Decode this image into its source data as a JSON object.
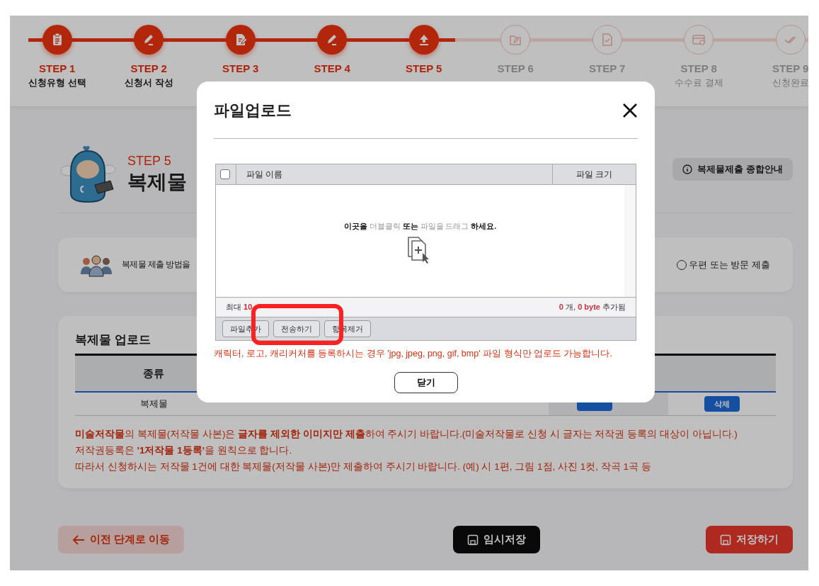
{
  "steps": [
    {
      "label": "STEP 1",
      "sublabel": "신청유형 선택",
      "done": true
    },
    {
      "label": "STEP 2",
      "sublabel": "신청서 작성",
      "done": true
    },
    {
      "label": "STEP 3",
      "done": true
    },
    {
      "label": "STEP 4",
      "done": true
    },
    {
      "label": "STEP 5",
      "done": true
    },
    {
      "label": "STEP 6",
      "done": false
    },
    {
      "label": "STEP 7",
      "done": false
    },
    {
      "label": "STEP 8",
      "sublabel": "수수료 결제",
      "done": false
    },
    {
      "label": "STEP 9",
      "sublabel": "신청완료",
      "done": false
    }
  ],
  "page_title": {
    "step": "STEP 5",
    "title": "복제물"
  },
  "guide_button": "복제물제출 종합안내",
  "method": {
    "label": "복제물 제출 방법을",
    "options": [
      {
        "label": "우편 또는 방문 제출",
        "selected": false
      }
    ]
  },
  "upload_section": {
    "title": "복제물 업로드",
    "columns": [
      "종류"
    ],
    "rows": [
      {
        "cells": [
          "복제물"
        ],
        "delete_button": "삭제"
      }
    ]
  },
  "notes": [
    "**미술저작물**의 복제물(저작물 사본)은 **글자를 제외한 이미지만 제출**하여 주시기 바랍니다.(미술저작물로 신청 시 글자는 저작권 등록의 대상이 아닙니다.)",
    "저작권등록은 **'1저작물 1등록'**을 원칙으로 합니다.",
    "따라서 신청하시는 저작물 1건에 대한 복제물(저작물 사본)만 제출하여 주시기 바랍니다. (예) 시 1편, 그림 1점, 사진 1컷, 작곡 1곡 등"
  ],
  "actions": {
    "back": "이전 단계로 이동",
    "temp_save": "임시저장",
    "save": "저장하기"
  },
  "modal": {
    "title": "파일업로드",
    "columns": [
      "파일 이름",
      "파일 크기"
    ],
    "select_all_checked": false,
    "hint": [
      {
        "text": "이곳을 ",
        "kind": "plain"
      },
      {
        "text": "더블클릭",
        "kind": "muted"
      },
      {
        "text": " 또는 ",
        "kind": "plain"
      },
      {
        "text": "파일을 드래그",
        "kind": "muted"
      },
      {
        "text": " 하세요.",
        "kind": "plain"
      }
    ],
    "limit": "최대 **10**",
    "summary": "**0** 개, **0 byte** 추가됨",
    "buttons": [
      "파일추가",
      "전송하기",
      "항목제거"
    ],
    "caption": "캐릭터, 로고, 캐리커처를 등록하시는 경우 'jpg, jpeg, png, gif, bmp' 파일 형식만 업로드 가능합니다.",
    "close_button": "닫기"
  }
}
